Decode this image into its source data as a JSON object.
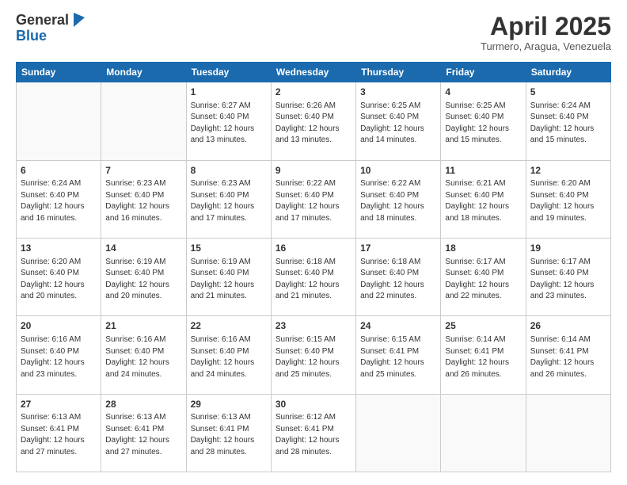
{
  "logo": {
    "general": "General",
    "blue": "Blue"
  },
  "title": "April 2025",
  "location": "Turmero, Aragua, Venezuela",
  "header_days": [
    "Sunday",
    "Monday",
    "Tuesday",
    "Wednesday",
    "Thursday",
    "Friday",
    "Saturday"
  ],
  "weeks": [
    [
      {
        "day": "",
        "info": ""
      },
      {
        "day": "",
        "info": ""
      },
      {
        "day": "1",
        "info": "Sunrise: 6:27 AM\nSunset: 6:40 PM\nDaylight: 12 hours and 13 minutes."
      },
      {
        "day": "2",
        "info": "Sunrise: 6:26 AM\nSunset: 6:40 PM\nDaylight: 12 hours and 13 minutes."
      },
      {
        "day": "3",
        "info": "Sunrise: 6:25 AM\nSunset: 6:40 PM\nDaylight: 12 hours and 14 minutes."
      },
      {
        "day": "4",
        "info": "Sunrise: 6:25 AM\nSunset: 6:40 PM\nDaylight: 12 hours and 15 minutes."
      },
      {
        "day": "5",
        "info": "Sunrise: 6:24 AM\nSunset: 6:40 PM\nDaylight: 12 hours and 15 minutes."
      }
    ],
    [
      {
        "day": "6",
        "info": "Sunrise: 6:24 AM\nSunset: 6:40 PM\nDaylight: 12 hours and 16 minutes."
      },
      {
        "day": "7",
        "info": "Sunrise: 6:23 AM\nSunset: 6:40 PM\nDaylight: 12 hours and 16 minutes."
      },
      {
        "day": "8",
        "info": "Sunrise: 6:23 AM\nSunset: 6:40 PM\nDaylight: 12 hours and 17 minutes."
      },
      {
        "day": "9",
        "info": "Sunrise: 6:22 AM\nSunset: 6:40 PM\nDaylight: 12 hours and 17 minutes."
      },
      {
        "day": "10",
        "info": "Sunrise: 6:22 AM\nSunset: 6:40 PM\nDaylight: 12 hours and 18 minutes."
      },
      {
        "day": "11",
        "info": "Sunrise: 6:21 AM\nSunset: 6:40 PM\nDaylight: 12 hours and 18 minutes."
      },
      {
        "day": "12",
        "info": "Sunrise: 6:20 AM\nSunset: 6:40 PM\nDaylight: 12 hours and 19 minutes."
      }
    ],
    [
      {
        "day": "13",
        "info": "Sunrise: 6:20 AM\nSunset: 6:40 PM\nDaylight: 12 hours and 20 minutes."
      },
      {
        "day": "14",
        "info": "Sunrise: 6:19 AM\nSunset: 6:40 PM\nDaylight: 12 hours and 20 minutes."
      },
      {
        "day": "15",
        "info": "Sunrise: 6:19 AM\nSunset: 6:40 PM\nDaylight: 12 hours and 21 minutes."
      },
      {
        "day": "16",
        "info": "Sunrise: 6:18 AM\nSunset: 6:40 PM\nDaylight: 12 hours and 21 minutes."
      },
      {
        "day": "17",
        "info": "Sunrise: 6:18 AM\nSunset: 6:40 PM\nDaylight: 12 hours and 22 minutes."
      },
      {
        "day": "18",
        "info": "Sunrise: 6:17 AM\nSunset: 6:40 PM\nDaylight: 12 hours and 22 minutes."
      },
      {
        "day": "19",
        "info": "Sunrise: 6:17 AM\nSunset: 6:40 PM\nDaylight: 12 hours and 23 minutes."
      }
    ],
    [
      {
        "day": "20",
        "info": "Sunrise: 6:16 AM\nSunset: 6:40 PM\nDaylight: 12 hours and 23 minutes."
      },
      {
        "day": "21",
        "info": "Sunrise: 6:16 AM\nSunset: 6:40 PM\nDaylight: 12 hours and 24 minutes."
      },
      {
        "day": "22",
        "info": "Sunrise: 6:16 AM\nSunset: 6:40 PM\nDaylight: 12 hours and 24 minutes."
      },
      {
        "day": "23",
        "info": "Sunrise: 6:15 AM\nSunset: 6:40 PM\nDaylight: 12 hours and 25 minutes."
      },
      {
        "day": "24",
        "info": "Sunrise: 6:15 AM\nSunset: 6:41 PM\nDaylight: 12 hours and 25 minutes."
      },
      {
        "day": "25",
        "info": "Sunrise: 6:14 AM\nSunset: 6:41 PM\nDaylight: 12 hours and 26 minutes."
      },
      {
        "day": "26",
        "info": "Sunrise: 6:14 AM\nSunset: 6:41 PM\nDaylight: 12 hours and 26 minutes."
      }
    ],
    [
      {
        "day": "27",
        "info": "Sunrise: 6:13 AM\nSunset: 6:41 PM\nDaylight: 12 hours and 27 minutes."
      },
      {
        "day": "28",
        "info": "Sunrise: 6:13 AM\nSunset: 6:41 PM\nDaylight: 12 hours and 27 minutes."
      },
      {
        "day": "29",
        "info": "Sunrise: 6:13 AM\nSunset: 6:41 PM\nDaylight: 12 hours and 28 minutes."
      },
      {
        "day": "30",
        "info": "Sunrise: 6:12 AM\nSunset: 6:41 PM\nDaylight: 12 hours and 28 minutes."
      },
      {
        "day": "",
        "info": ""
      },
      {
        "day": "",
        "info": ""
      },
      {
        "day": "",
        "info": ""
      }
    ]
  ]
}
